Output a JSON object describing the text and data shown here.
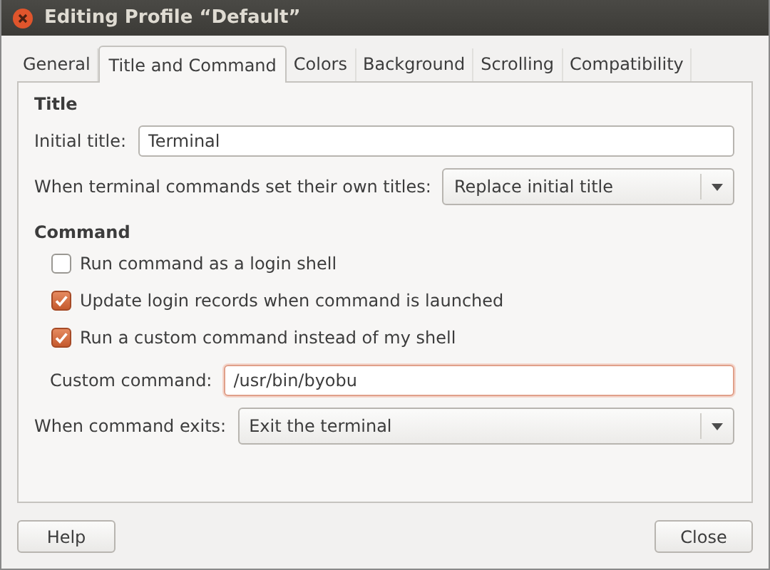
{
  "window": {
    "title": "Editing Profile “Default”"
  },
  "tabs": [
    {
      "label": "General",
      "selected": false
    },
    {
      "label": "Title and Command",
      "selected": true
    },
    {
      "label": "Colors",
      "selected": false
    },
    {
      "label": "Background",
      "selected": false
    },
    {
      "label": "Scrolling",
      "selected": false
    },
    {
      "label": "Compatibility",
      "selected": false
    }
  ],
  "sections": [
    {
      "heading": "Title",
      "rows": [
        {
          "kind": "text",
          "label": "Initial title:",
          "value": "Terminal",
          "focused": false
        },
        {
          "kind": "dropdown",
          "label": "When terminal commands set their own titles:",
          "value": "Replace initial title"
        }
      ]
    },
    {
      "heading": "Command",
      "rows": [
        {
          "kind": "checkbox",
          "label": "Run command as a login shell",
          "checked": false
        },
        {
          "kind": "checkbox",
          "label": "Update login records when command is launched",
          "checked": true
        },
        {
          "kind": "checkbox",
          "label": "Run a custom command instead of my shell",
          "checked": true
        },
        {
          "kind": "text",
          "label": "Custom command:",
          "value": "/usr/bin/byobu",
          "focused": true
        },
        {
          "kind": "dropdown",
          "label": "When command exits:",
          "value": "Exit the terminal"
        }
      ]
    }
  ],
  "buttons": [
    "Help",
    "Close"
  ]
}
